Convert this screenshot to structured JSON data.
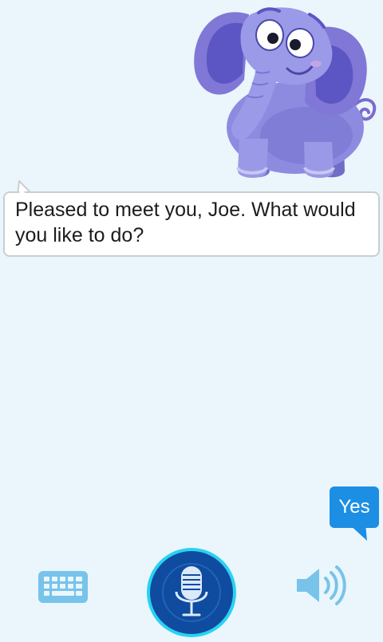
{
  "conversation": {
    "assistant_message": "Pleased to meet you, Joe. What would you like to do?",
    "user_message": "Yes"
  },
  "toolbar": {
    "left_icon": "keyboard-icon",
    "center_icon": "microphone-icon",
    "right_icon": "speaker-icon"
  },
  "colors": {
    "background": "#eaf6fc",
    "user_bubble": "#1c8fe4",
    "toolbar_icon": "#78c3ea",
    "mic_button": "#0f4b9f",
    "mic_ring": "#29d2f2",
    "mascot": "#8c8be0"
  }
}
